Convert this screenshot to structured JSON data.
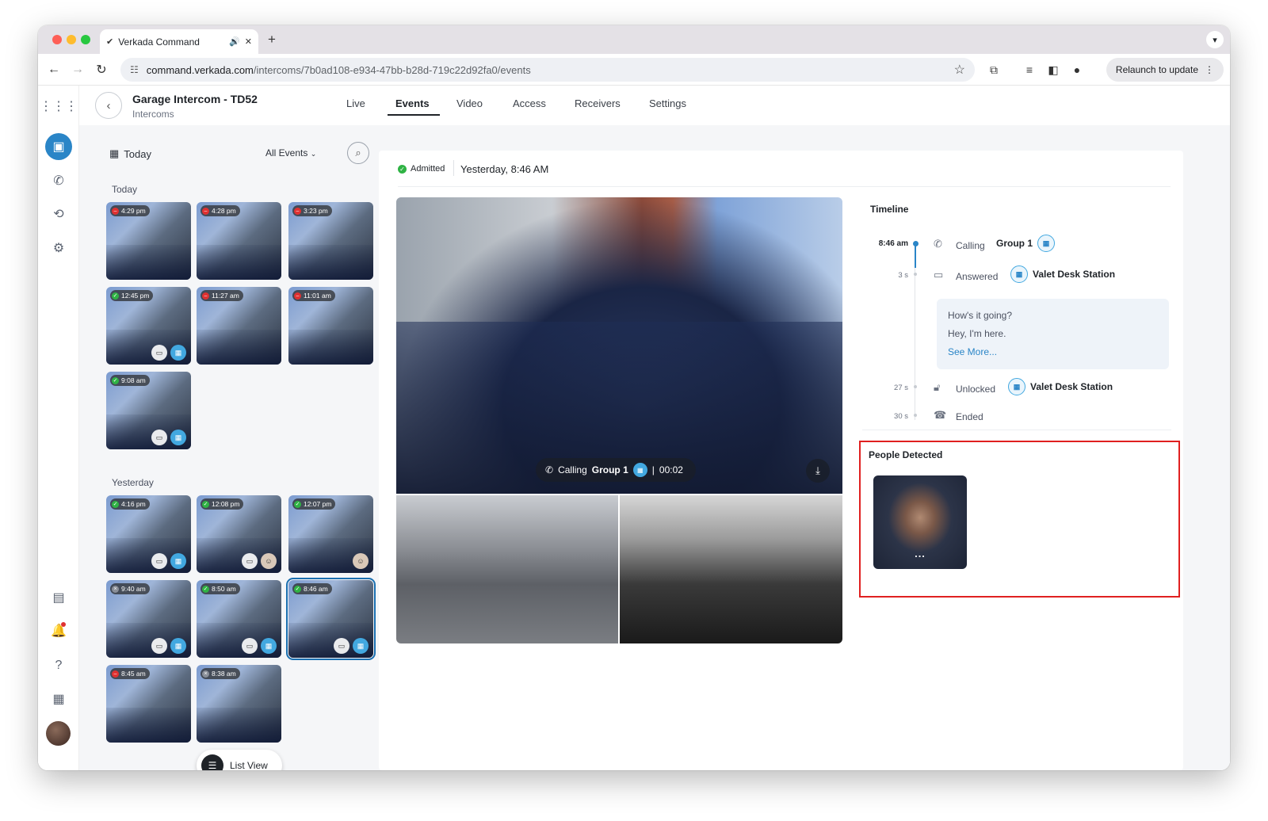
{
  "browser": {
    "tab_title": "Verkada Command",
    "url_host": "command.verkada.com",
    "url_path": "/intercoms/7b0ad108-e934-47bb-b28d-719c22d92fa0/events",
    "relaunch_label": "Relaunch to update"
  },
  "header": {
    "device_title": "Garage Intercom - TD52",
    "device_subtitle": "Intercoms",
    "tabs": [
      "Live",
      "Events",
      "Video",
      "Access",
      "Receivers",
      "Settings"
    ],
    "active_tab": "Events"
  },
  "sidebar": {
    "icons": [
      "apps-grid-icon",
      "intercom-icon",
      "call-list-icon",
      "history-icon",
      "settings-icon",
      "report-icon",
      "notification-icon",
      "help-icon",
      "calendar-icon"
    ]
  },
  "events_panel": {
    "date_filter": "Today",
    "event_filter": "All Events",
    "sections": [
      {
        "label": "Today",
        "events": [
          {
            "time": "4:29 pm",
            "status": "denied",
            "badges": []
          },
          {
            "time": "4:28 pm",
            "status": "denied",
            "badges": []
          },
          {
            "time": "3:23 pm",
            "status": "denied",
            "badges": []
          },
          {
            "time": "12:45 pm",
            "status": "admitted",
            "badges": [
              "chat",
              "grid"
            ]
          },
          {
            "time": "11:27 am",
            "status": "denied",
            "badges": []
          },
          {
            "time": "11:01 am",
            "status": "denied",
            "badges": []
          },
          {
            "time": "9:08 am",
            "status": "admitted",
            "badges": [
              "chat",
              "grid"
            ]
          }
        ]
      },
      {
        "label": "Yesterday",
        "events": [
          {
            "time": "4:16 pm",
            "status": "admitted",
            "badges": [
              "chat",
              "grid"
            ]
          },
          {
            "time": "12:08 pm",
            "status": "admitted",
            "badges": [
              "chat",
              "face"
            ]
          },
          {
            "time": "12:07 pm",
            "status": "admitted",
            "badges": [
              "face"
            ]
          },
          {
            "time": "9:40 am",
            "status": "missed",
            "badges": [
              "chat",
              "grid"
            ]
          },
          {
            "time": "8:50 am",
            "status": "admitted",
            "badges": [
              "chat",
              "grid"
            ]
          },
          {
            "time": "8:46 am",
            "status": "admitted",
            "badges": [
              "chat",
              "grid"
            ],
            "selected": true
          },
          {
            "time": "8:45 am",
            "status": "denied",
            "badges": []
          },
          {
            "time": "8:38 am",
            "status": "missed",
            "badges": []
          }
        ]
      }
    ],
    "list_view_label": "List View"
  },
  "event_detail": {
    "status": "Admitted",
    "timestamp": "Yesterday, 8:46 AM",
    "call_overlay": {
      "label": "Calling",
      "group": "Group 1",
      "duration": "00:02"
    },
    "timeline_title": "Timeline",
    "timeline": [
      {
        "time": "8:46 am",
        "action": "Calling",
        "who": "Group 1"
      },
      {
        "time": "3 s",
        "action": "Answered",
        "who": "Valet Desk Station"
      },
      {
        "time": "27 s",
        "action": "Unlocked",
        "who": "Valet Desk Station"
      },
      {
        "time": "30 s",
        "action": "Ended",
        "who": ""
      }
    ],
    "transcript": {
      "lines": [
        "How's it going?",
        "Hey, I'm here."
      ],
      "see_more": "See More..."
    },
    "people_detected_title": "People Detected",
    "face_menu": "..."
  }
}
